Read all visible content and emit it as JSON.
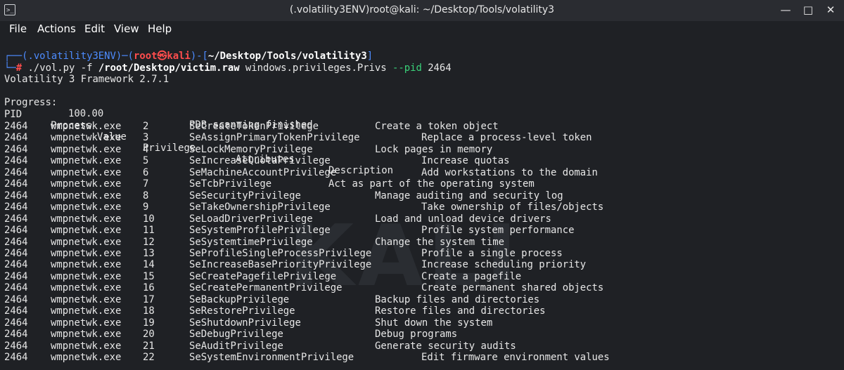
{
  "window": {
    "title": "(.volatility3ENV)root@kali: ~/Desktop/Tools/volatility3",
    "app_icon": "terminal-icon",
    "controls": [
      "minimize-icon",
      "maximize-icon",
      "close-icon"
    ]
  },
  "menu": [
    "File",
    "Actions",
    "Edit",
    "View",
    "Help"
  ],
  "prompt": {
    "env": "(.volatility3ENV)",
    "user": "root",
    "at_symbol": "㉿",
    "host": "kali",
    "path": "~/Desktop/Tools/volatility3",
    "command_pre": "./vol.py -f ",
    "command_file": "/root/Desktop/victim.raw",
    "command_post": " windows.privileges.Privs ",
    "command_flag": "--pid",
    "command_arg": " 2464"
  },
  "output": {
    "framework": "Volatility 3 Framework 2.7.1",
    "progress_label": "Progress:",
    "progress_value": "100.00",
    "progress_status": "PDB scanning finished",
    "headers": [
      "PID",
      "Process",
      "Value",
      "Privilege",
      "Attributes",
      "Description"
    ],
    "rows": [
      {
        "pid": "2464",
        "process": "wmpnetwk.exe",
        "value": "2",
        "privilege": "SeCreateTokenPrivilege",
        "description": "Create a token object",
        "indent": 1
      },
      {
        "pid": "2464",
        "process": "wmpnetwk.exe",
        "value": "3",
        "privilege": "SeAssignPrimaryTokenPrivilege",
        "description": "Replace a process-level token",
        "indent": 2
      },
      {
        "pid": "2464",
        "process": "wmpnetwk.exe",
        "value": "4",
        "privilege": "SeLockMemoryPrivilege",
        "description": "Lock pages in memory",
        "indent": 1
      },
      {
        "pid": "2464",
        "process": "wmpnetwk.exe",
        "value": "5",
        "privilege": "SeIncreaseQuotaPrivilege",
        "description": "Increase quotas",
        "indent": 2
      },
      {
        "pid": "2464",
        "process": "wmpnetwk.exe",
        "value": "6",
        "privilege": "SeMachineAccountPrivilege",
        "description": "Add workstations to the domain",
        "indent": 2
      },
      {
        "pid": "2464",
        "process": "wmpnetwk.exe",
        "value": "7",
        "privilege": "SeTcbPrivilege",
        "description": "Act as part of the operating system",
        "indent": 0
      },
      {
        "pid": "2464",
        "process": "wmpnetwk.exe",
        "value": "8",
        "privilege": "SeSecurityPrivilege",
        "description": "Manage auditing and security log",
        "indent": 1
      },
      {
        "pid": "2464",
        "process": "wmpnetwk.exe",
        "value": "9",
        "privilege": "SeTakeOwnershipPrivilege",
        "description": "Take ownership of files/objects",
        "indent": 2
      },
      {
        "pid": "2464",
        "process": "wmpnetwk.exe",
        "value": "10",
        "privilege": "SeLoadDriverPrivilege",
        "description": "Load and unload device drivers",
        "indent": 1
      },
      {
        "pid": "2464",
        "process": "wmpnetwk.exe",
        "value": "11",
        "privilege": "SeSystemProfilePrivilege",
        "description": "Profile system performance",
        "indent": 2
      },
      {
        "pid": "2464",
        "process": "wmpnetwk.exe",
        "value": "12",
        "privilege": "SeSystemtimePrivilege",
        "description": "Change the system time",
        "indent": 1
      },
      {
        "pid": "2464",
        "process": "wmpnetwk.exe",
        "value": "13",
        "privilege": "SeProfileSingleProcessPrivilege",
        "description": "Profile a single process",
        "indent": 2
      },
      {
        "pid": "2464",
        "process": "wmpnetwk.exe",
        "value": "14",
        "privilege": "SeIncreaseBasePriorityPrivilege",
        "description": "Increase scheduling priority",
        "indent": 2
      },
      {
        "pid": "2464",
        "process": "wmpnetwk.exe",
        "value": "15",
        "privilege": "SeCreatePagefilePrivilege",
        "description": "Create a pagefile",
        "indent": 2
      },
      {
        "pid": "2464",
        "process": "wmpnetwk.exe",
        "value": "16",
        "privilege": "SeCreatePermanentPrivilege",
        "description": "Create permanent shared objects",
        "indent": 2
      },
      {
        "pid": "2464",
        "process": "wmpnetwk.exe",
        "value": "17",
        "privilege": "SeBackupPrivilege",
        "description": "Backup files and directories",
        "indent": 1
      },
      {
        "pid": "2464",
        "process": "wmpnetwk.exe",
        "value": "18",
        "privilege": "SeRestorePrivilege",
        "description": "Restore files and directories",
        "indent": 1
      },
      {
        "pid": "2464",
        "process": "wmpnetwk.exe",
        "value": "19",
        "privilege": "SeShutdownPrivilege",
        "description": "Shut down the system",
        "indent": 1
      },
      {
        "pid": "2464",
        "process": "wmpnetwk.exe",
        "value": "20",
        "privilege": "SeDebugPrivilege",
        "description": "Debug programs",
        "indent": 1
      },
      {
        "pid": "2464",
        "process": "wmpnetwk.exe",
        "value": "21",
        "privilege": "SeAuditPrivilege",
        "description": "Generate security audits",
        "indent": 1
      },
      {
        "pid": "2464",
        "process": "wmpnetwk.exe",
        "value": "22",
        "privilege": "SeSystemEnvironmentPrivilege",
        "description": "Edit firmware environment values",
        "indent": 2
      }
    ]
  }
}
